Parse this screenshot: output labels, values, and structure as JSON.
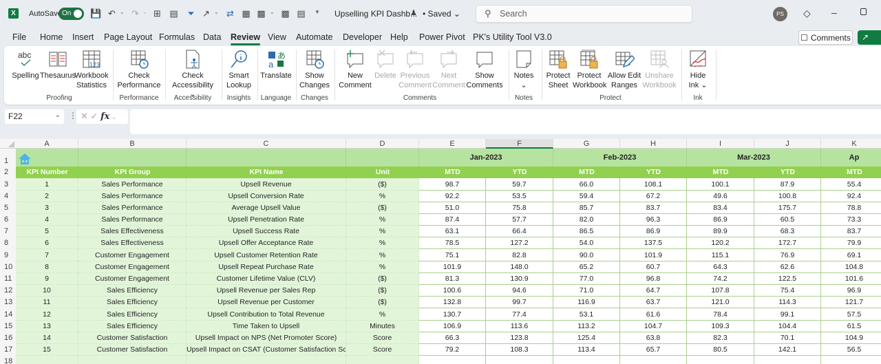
{
  "titlebar": {
    "app_icon": "excel-icon",
    "autosave_label": "AutoSave",
    "autosave_state": "On",
    "document_title": "Upselling KPI Dashb...",
    "save_status": "• Saved",
    "search_placeholder": "Search",
    "user_initials": "PS"
  },
  "menu": {
    "tabs": [
      "File",
      "Home",
      "Insert",
      "Page Layout",
      "Formulas",
      "Data",
      "Review",
      "View",
      "Automate",
      "Developer",
      "Help",
      "Power Pivot",
      "PK's Utility Tool V3.0"
    ],
    "active_tab": "Review",
    "comments_button": "Comments",
    "share_button": "Share"
  },
  "ribbon": {
    "groups": [
      {
        "label": "Proofing",
        "buttons": [
          {
            "label": "Spelling",
            "icon": "spelling-icon"
          },
          {
            "label": "Thesaurus",
            "icon": "thesaurus-icon"
          },
          {
            "label": "Workbook Statistics",
            "icon": "workbook-statistics-icon"
          }
        ]
      },
      {
        "label": "Performance",
        "buttons": [
          {
            "label": "Check Performance",
            "icon": "check-performance-icon"
          }
        ]
      },
      {
        "label": "Accessibility",
        "buttons": [
          {
            "label": "Check Accessibility",
            "icon": "check-accessibility-icon"
          }
        ]
      },
      {
        "label": "Insights",
        "buttons": [
          {
            "label": "Smart Lookup",
            "icon": "smart-lookup-icon"
          }
        ]
      },
      {
        "label": "Language",
        "buttons": [
          {
            "label": "Translate",
            "icon": "translate-icon"
          }
        ]
      },
      {
        "label": "Changes",
        "buttons": [
          {
            "label": "Show Changes",
            "icon": "show-changes-icon"
          }
        ]
      },
      {
        "label": "Comments",
        "buttons": [
          {
            "label": "New Comment",
            "icon": "new-comment-icon"
          },
          {
            "label": "Delete",
            "icon": "delete-comment-icon",
            "disabled": true
          },
          {
            "label": "Previous Comment",
            "icon": "previous-comment-icon",
            "disabled": true
          },
          {
            "label": "Next Comment",
            "icon": "next-comment-icon",
            "disabled": true
          },
          {
            "label": "Show Comments",
            "icon": "show-comments-icon"
          }
        ]
      },
      {
        "label": "Notes",
        "buttons": [
          {
            "label": "Notes",
            "icon": "notes-icon"
          }
        ]
      },
      {
        "label": "Protect",
        "buttons": [
          {
            "label": "Protect Sheet",
            "icon": "protect-sheet-icon"
          },
          {
            "label": "Protect Workbook",
            "icon": "protect-workbook-icon"
          },
          {
            "label": "Allow Edit Ranges",
            "icon": "allow-edit-ranges-icon"
          },
          {
            "label": "Unshare Workbook",
            "icon": "unshare-workbook-icon",
            "disabled": true
          }
        ]
      },
      {
        "label": "Ink",
        "buttons": [
          {
            "label": "Hide Ink",
            "icon": "hide-ink-icon"
          }
        ]
      }
    ]
  },
  "formula_bar": {
    "name_box": "F22",
    "formula": ""
  },
  "sheet": {
    "columns": [
      "A",
      "B",
      "C",
      "D",
      "E",
      "F",
      "G",
      "H",
      "I",
      "J",
      "K"
    ],
    "selected_column": "F",
    "months": [
      "Jan-2023",
      "Feb-2023",
      "Mar-2023",
      "Ap"
    ],
    "headers": [
      "KPI Number",
      "KPI Group",
      "KPI Name",
      "Unit",
      "MTD",
      "YTD",
      "MTD",
      "YTD",
      "MTD",
      "YTD",
      "MTD"
    ],
    "row_numbers": [
      "1",
      "2",
      "3",
      "4",
      "5",
      "6",
      "7",
      "8",
      "9",
      "10",
      "11",
      "12",
      "13",
      "14",
      "15",
      "16",
      "17",
      "18"
    ],
    "rows": [
      [
        "1",
        "Sales Performance",
        "Upsell Revenue",
        "($)",
        "98.7",
        "59.7",
        "66.0",
        "108.1",
        "100.1",
        "87.9",
        "55.4"
      ],
      [
        "2",
        "Sales Performance",
        "Upsell Conversion Rate",
        "%",
        "92.2",
        "53.5",
        "59.4",
        "67.2",
        "49.6",
        "100.8",
        "92.4"
      ],
      [
        "3",
        "Sales Performance",
        "Average Upsell Value",
        "($)",
        "51.0",
        "75.8",
        "85.7",
        "83.7",
        "83.4",
        "175.7",
        "78.8"
      ],
      [
        "4",
        "Sales Performance",
        "Upsell Penetration Rate",
        "%",
        "87.4",
        "57.7",
        "82.0",
        "96.3",
        "86.9",
        "60.5",
        "73.3"
      ],
      [
        "5",
        "Sales Effectiveness",
        "Upsell Success Rate",
        "%",
        "63.1",
        "66.4",
        "86.5",
        "86.9",
        "89.9",
        "68.3",
        "83.7"
      ],
      [
        "6",
        "Sales Effectiveness",
        "Upsell Offer Acceptance Rate",
        "%",
        "78.5",
        "127.2",
        "54.0",
        "137.5",
        "120.2",
        "172.7",
        "79.9"
      ],
      [
        "7",
        "Customer Engagement",
        "Upsell Customer Retention Rate",
        "%",
        "75.1",
        "82.8",
        "90.0",
        "101.9",
        "115.1",
        "76.9",
        "69.1"
      ],
      [
        "8",
        "Customer Engagement",
        "Upsell Repeat Purchase Rate",
        "%",
        "101.9",
        "148.0",
        "65.2",
        "60.7",
        "64.3",
        "62.6",
        "104.8"
      ],
      [
        "9",
        "Customer Engagement",
        "Customer Lifetime Value (CLV)",
        "($)",
        "81.3",
        "130.9",
        "77.0",
        "96.8",
        "74.2",
        "122.5",
        "101.6"
      ],
      [
        "10",
        "Sales Efficiency",
        "Upsell Revenue per Sales Rep",
        "($)",
        "100.6",
        "94.6",
        "71.0",
        "64.7",
        "107.8",
        "75.4",
        "96.9"
      ],
      [
        "11",
        "Sales Efficiency",
        "Upsell Revenue per Customer",
        "($)",
        "132.8",
        "99.7",
        "116.9",
        "63.7",
        "121.0",
        "114.3",
        "121.7"
      ],
      [
        "12",
        "Sales Efficiency",
        "Upsell Contribution to Total Revenue",
        "%",
        "130.7",
        "77.4",
        "53.1",
        "61.6",
        "78.4",
        "99.1",
        "57.5"
      ],
      [
        "13",
        "Sales Efficiency",
        "Time Taken to Upsell",
        "Minutes",
        "106.9",
        "113.6",
        "113.2",
        "104.7",
        "109.3",
        "104.4",
        "61.5"
      ],
      [
        "14",
        "Customer Satisfaction",
        "Upsell Impact on NPS (Net Promoter Score)",
        "Score",
        "66.3",
        "123.8",
        "125.4",
        "63.8",
        "82.3",
        "70.1",
        "104.9"
      ],
      [
        "15",
        "Customer Satisfaction",
        "Upsell Impact on CSAT (Customer Satisfaction Score)",
        "Score",
        "79.2",
        "108.3",
        "113.4",
        "65.7",
        "80.5",
        "142.1",
        "56.5"
      ]
    ]
  },
  "colors": {
    "accent": "#107c41",
    "header_row_fill": "#92d050",
    "month_row_fill": "#b6e3a0",
    "left_block_fill": "#e2f5d9"
  }
}
